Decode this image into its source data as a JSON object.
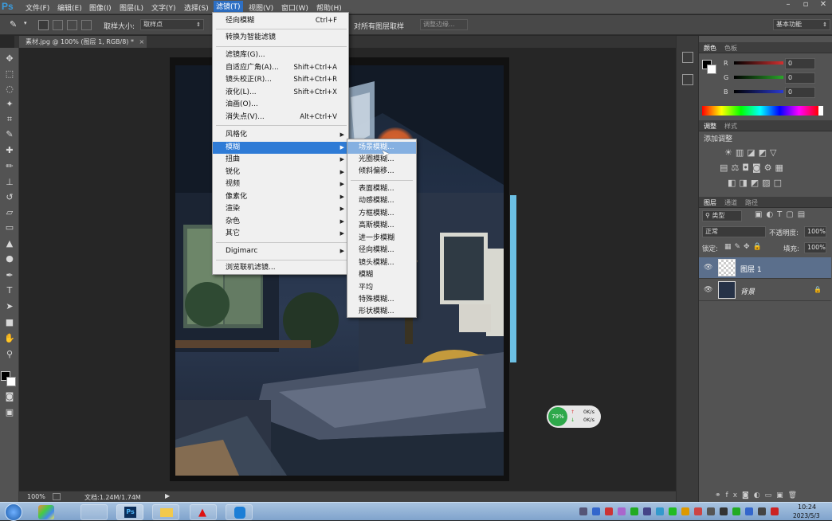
{
  "app": {
    "logo": "Ps"
  },
  "menubar": {
    "items": [
      "文件(F)",
      "编辑(E)",
      "图像(I)",
      "图层(L)",
      "文字(Y)",
      "选择(S)",
      "滤镜(T)",
      "视图(V)",
      "窗口(W)",
      "帮助(H)"
    ],
    "active": "滤镜(T)"
  },
  "options": {
    "sample_size_label": "取样大小:",
    "sample_size_value": "取样点",
    "sample_all_label": "对所有图层取样",
    "refine_button": "调整边缘...",
    "workspace": "基本功能"
  },
  "document": {
    "tab_title": "素材.jpg @ 100% (图层 1, RGB/8) *",
    "close": "×"
  },
  "status": {
    "zoom": "100%",
    "doc_info": "文档:1.24M/1.74M"
  },
  "filter_menu": {
    "items": [
      {
        "label": "径向模糊",
        "shortcut": "Ctrl+F"
      },
      {
        "label": "转换为智能滤镜",
        "shortcut": ""
      },
      {
        "label": "滤镜库(G)...",
        "shortcut": ""
      },
      {
        "label": "自适应广角(A)...",
        "shortcut": "Shift+Ctrl+A"
      },
      {
        "label": "镜头校正(R)...",
        "shortcut": "Shift+Ctrl+R"
      },
      {
        "label": "液化(L)...",
        "shortcut": "Shift+Ctrl+X"
      },
      {
        "label": "油画(O)...",
        "shortcut": ""
      },
      {
        "label": "消失点(V)...",
        "shortcut": "Alt+Ctrl+V"
      },
      {
        "label": "风格化",
        "shortcut": ""
      },
      {
        "label": "模糊",
        "shortcut": ""
      },
      {
        "label": "扭曲",
        "shortcut": ""
      },
      {
        "label": "锐化",
        "shortcut": ""
      },
      {
        "label": "视频",
        "shortcut": ""
      },
      {
        "label": "像素化",
        "shortcut": ""
      },
      {
        "label": "渲染",
        "shortcut": ""
      },
      {
        "label": "杂色",
        "shortcut": ""
      },
      {
        "label": "其它",
        "shortcut": ""
      },
      {
        "label": "Digimarc",
        "shortcut": ""
      },
      {
        "label": "浏览联机滤镜...",
        "shortcut": ""
      }
    ]
  },
  "blur_submenu": {
    "items": [
      "场景模糊...",
      "光圈模糊...",
      "倾斜偏移...",
      "表面模糊...",
      "动感模糊...",
      "方框模糊...",
      "高斯模糊...",
      "进一步模糊",
      "径向模糊...",
      "镜头模糊...",
      "模糊",
      "平均",
      "特殊模糊...",
      "形状模糊..."
    ],
    "highlighted": "场景模糊..."
  },
  "color_panel": {
    "tabs": [
      "颜色",
      "色板"
    ],
    "channels": [
      {
        "label": "R",
        "value": "0"
      },
      {
        "label": "G",
        "value": "0"
      },
      {
        "label": "B",
        "value": "0"
      }
    ],
    "colors": {
      "r": "#d23030",
      "g": "#2aa52a",
      "b": "#2a3ad2"
    }
  },
  "adjust_panel": {
    "tabs": [
      "调整",
      "样式"
    ],
    "title": "添加调整"
  },
  "layers_panel": {
    "tabs": [
      "图层",
      "通道",
      "路径"
    ],
    "kind_filter": "类型",
    "blend_mode": "正常",
    "opacity_label": "不透明度:",
    "opacity_value": "100%",
    "lock_label": "锁定:",
    "fill_label": "填充:",
    "fill_value": "100%",
    "layers": [
      {
        "name": "图层 1",
        "selected": true
      },
      {
        "name": "背景",
        "selected": false
      }
    ]
  },
  "network_widget": {
    "percent": "79%",
    "up": "0K/s",
    "down": "0K/s"
  },
  "taskbar": {
    "time": "10:24",
    "date": "2023/5/3"
  }
}
